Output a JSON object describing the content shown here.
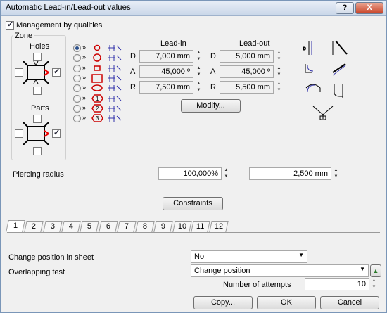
{
  "window": {
    "title": "Automatic Lead-in/Lead-out values",
    "help_label": "?",
    "close_label": "X"
  },
  "management": {
    "label": "Management by qualities",
    "checked": true
  },
  "zone": {
    "label": "Zone",
    "holes_label": "Holes",
    "parts_label": "Parts"
  },
  "shape_selector": {
    "arrow": "»",
    "options": [
      "1",
      "2",
      "3"
    ]
  },
  "leadin": {
    "header": "Lead-in",
    "rows": [
      {
        "key": "D",
        "value": "7,000 mm"
      },
      {
        "key": "A",
        "value": "45,000 º"
      },
      {
        "key": "R",
        "value": "7,500 mm"
      }
    ]
  },
  "leadout": {
    "header": "Lead-out",
    "rows": [
      {
        "key": "D",
        "value": "5,000 mm"
      },
      {
        "key": "A",
        "value": "45,000 º"
      },
      {
        "key": "R",
        "value": "5,500 mm"
      }
    ]
  },
  "modify_label": "Modify...",
  "piercing": {
    "label": "Piercing radius",
    "percent": "100,000%",
    "mm": "2,500 mm"
  },
  "constraints_label": "Constraints",
  "tabs": [
    "1",
    "2",
    "3",
    "4",
    "5",
    "6",
    "7",
    "8",
    "9",
    "10",
    "11",
    "12"
  ],
  "active_tab": 0,
  "change_position": {
    "label": "Change position in sheet",
    "value": "No"
  },
  "overlapping": {
    "label": "Overlapping test",
    "value": "Change position"
  },
  "attempts": {
    "label": "Number of attempts",
    "value": "10"
  },
  "buttons": {
    "copy": "Copy...",
    "ok": "OK",
    "cancel": "Cancel"
  }
}
